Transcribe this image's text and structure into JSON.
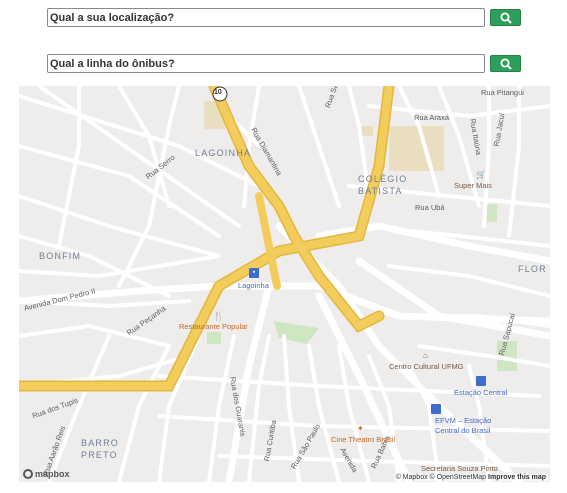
{
  "search_location": {
    "placeholder": "Qual a sua localização?"
  },
  "search_line": {
    "placeholder": "Qual a linha do ônibus?"
  },
  "map": {
    "districts": [
      "LAGOINHA",
      "COLÉGIO",
      "BATISTA",
      "BONFIM",
      "FLOR",
      "BARRO",
      "PRETO"
    ],
    "streets": [
      "Rua Sabará",
      "Rua Pitangui",
      "Rua Diamantina",
      "Rua Serro",
      "Rua Araxá",
      "Rua Itaúna",
      "Rua Jacuí",
      "Rua Ubá",
      "Avenida Dom Pedro II",
      "Rua Peçanha",
      "Rua dos Tupis",
      "Rua Curitiba",
      "Rua São Paulo",
      "Rua dos Guaranis",
      "Avenida",
      "Rua Bahia",
      "Rua Sapucaí",
      "Rua Aarão Reis"
    ],
    "route_badge": "10",
    "pois": {
      "super_mais": "Super Mais",
      "lagoinha_station": "Lagoinha",
      "restaurante": "Restaurante Popular",
      "centro_cultural": "Centro Cultural UFMG",
      "estacao_central": "Estação Central",
      "efvm_1": "EFVM – Estação",
      "efvm_2": "Central do Brasil",
      "cine": "Cine Theatro Brasil",
      "secretaria": "Secretaria Souza Pinto"
    },
    "attribution": {
      "mapbox": "© Mapbox",
      "osm": "© OpenStreetMap",
      "improve": "Improve this map"
    },
    "logo": "mapbox"
  },
  "colors": {
    "button": "#2e9e5b",
    "highway": "#f3cd5c",
    "park": "#cfe6c3",
    "map_bg": "#efedeb"
  }
}
